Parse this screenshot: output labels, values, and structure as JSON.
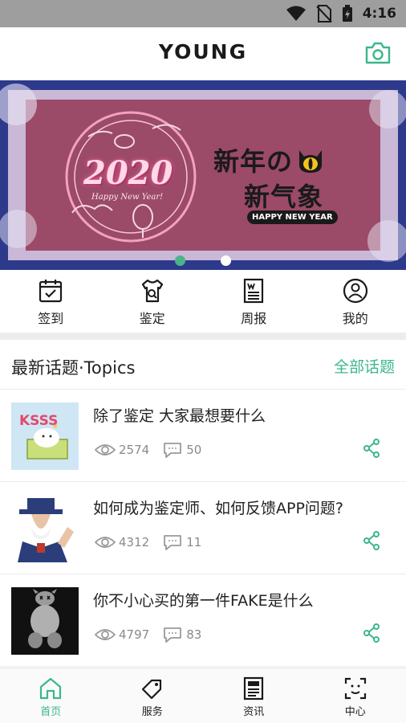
{
  "status_bar": {
    "time": "4:16"
  },
  "app_bar": {
    "title": "YOUNG"
  },
  "banner": {
    "year": "2020",
    "greeting": "Happy New Year!",
    "headline_line1": "新年の",
    "headline_line2": "新气象",
    "tagline": "HAPPY NEW YEAR",
    "slide_count": 2,
    "active_slide": 1
  },
  "quick_nav": [
    {
      "label": "签到",
      "icon": "calendar-check-icon"
    },
    {
      "label": "鉴定",
      "icon": "shirt-search-icon"
    },
    {
      "label": "周报",
      "icon": "newspaper-icon"
    },
    {
      "label": "我的",
      "icon": "user-circle-icon"
    }
  ],
  "topics": {
    "title": "最新话题·Topics",
    "all_label": "全部话题",
    "items": [
      {
        "title": "除了鉴定 大家最想要什么",
        "views": "2574",
        "comments": "50"
      },
      {
        "title": "如何成为鉴定师、如何反馈APP问题?",
        "views": "4312",
        "comments": "11"
      },
      {
        "title": "你不小心买的第一件FAKE是什么",
        "views": "4797",
        "comments": "83"
      }
    ]
  },
  "tab_bar": [
    {
      "label": "首页",
      "icon": "home-icon",
      "active": true
    },
    {
      "label": "服务",
      "icon": "tag-icon",
      "active": false
    },
    {
      "label": "资讯",
      "icon": "news-icon",
      "active": false
    },
    {
      "label": "中心",
      "icon": "face-scan-icon",
      "active": false
    }
  ],
  "colors": {
    "accent": "#3bb78a",
    "banner_bg": "#9b4a68",
    "banner_frame": "#2d3a8c"
  }
}
